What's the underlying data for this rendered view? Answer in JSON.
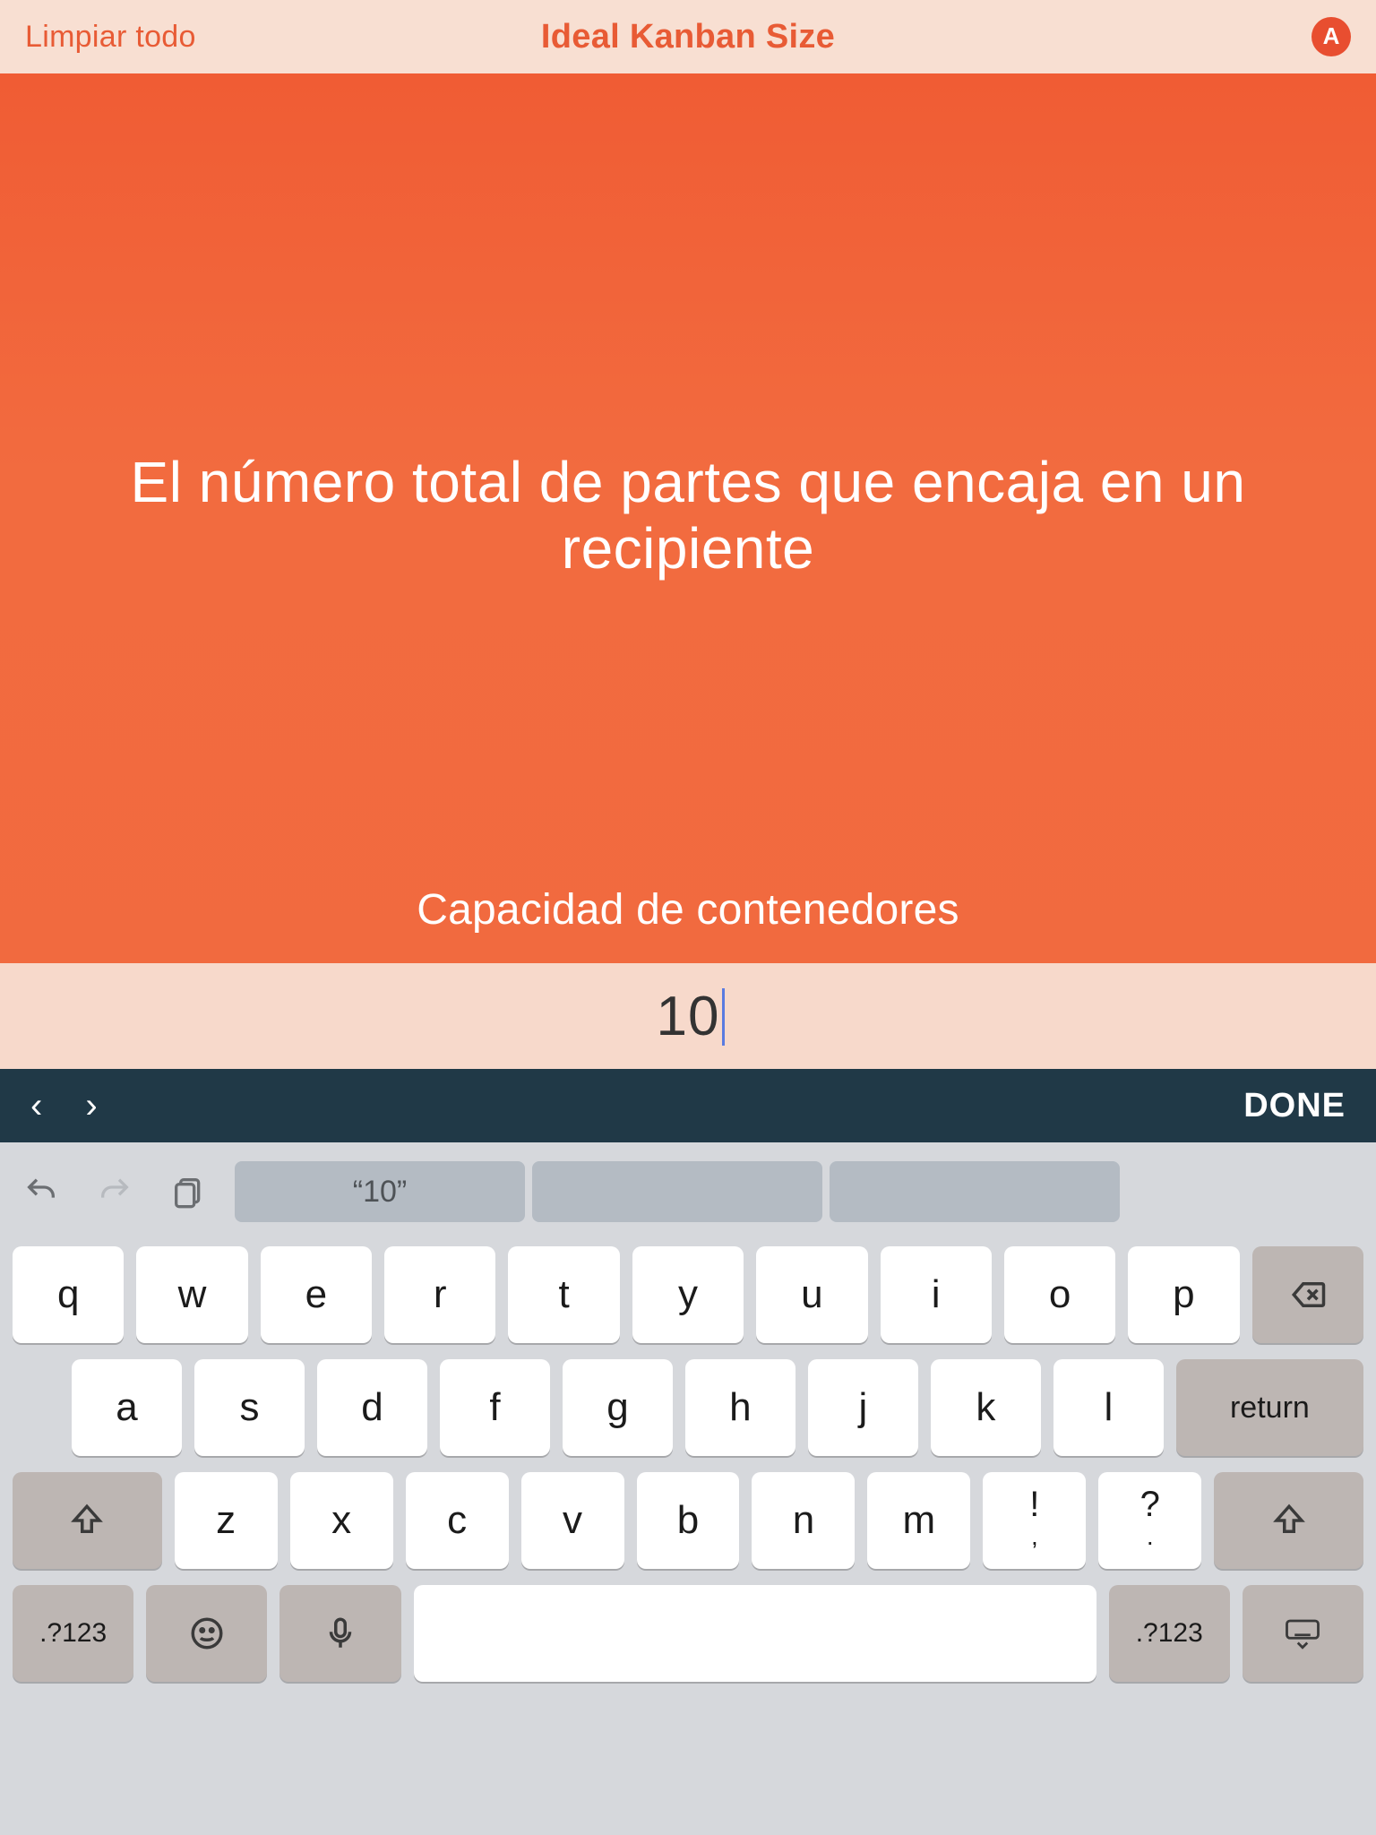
{
  "header": {
    "clear_label": "Limpiar todo",
    "title": "Ideal Kanban Size",
    "brand_letter": "A"
  },
  "main": {
    "prompt": "El número total de partes que encaja en un recipiente",
    "field_label": "Capacidad de contenedores",
    "input_value": "10"
  },
  "accessory": {
    "done_label": "DONE"
  },
  "keyboard": {
    "suggestion_primary": "“10”",
    "row1": [
      "q",
      "w",
      "e",
      "r",
      "t",
      "y",
      "u",
      "i",
      "o",
      "p"
    ],
    "row2": [
      "a",
      "s",
      "d",
      "f",
      "g",
      "h",
      "j",
      "k",
      "l"
    ],
    "row3": [
      "z",
      "x",
      "c",
      "v",
      "b",
      "n",
      "m"
    ],
    "punct1_top": "!",
    "punct1_bottom": ",",
    "punct2_top": "?",
    "punct2_bottom": ".",
    "return_label": "return",
    "mode_label": ".?123"
  }
}
